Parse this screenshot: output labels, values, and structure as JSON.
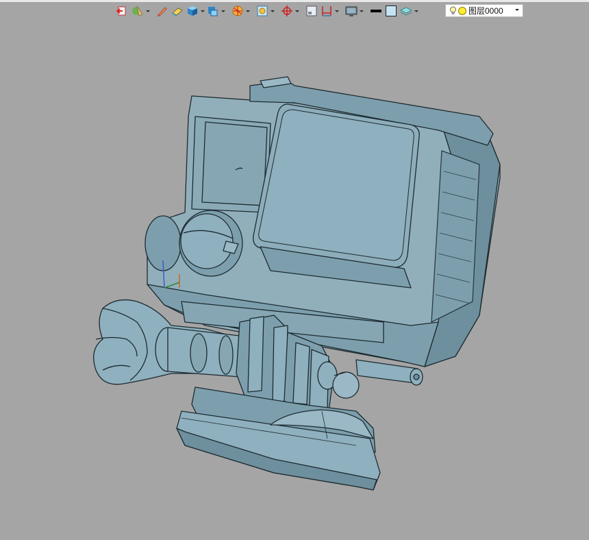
{
  "toolbar": {
    "items": [
      {
        "name": "exit-icon",
        "caret": false
      },
      {
        "name": "render-mode-icon",
        "caret": true
      },
      {
        "name": "pen-icon",
        "caret": false
      },
      {
        "name": "eraser-icon",
        "caret": false
      },
      {
        "name": "cube-icon",
        "caret": true
      },
      {
        "name": "solid-view-icon",
        "caret": true
      },
      {
        "name": "sphere-icon",
        "caret": true
      },
      {
        "name": "frame-icon",
        "caret": true
      },
      {
        "name": "target-icon",
        "caret": true
      },
      {
        "name": "layout-icon",
        "caret": false
      },
      {
        "name": "dimension-icon",
        "caret": true
      },
      {
        "name": "display-icon",
        "caret": true
      },
      {
        "name": "line-weight-icon",
        "caret": false
      },
      {
        "name": "color-swatch-icon",
        "caret": false
      },
      {
        "name": "layers-icon",
        "caret": true
      }
    ]
  },
  "layer": {
    "current": "图层0000"
  },
  "colors": {
    "background": "#a5a5a5",
    "model_fill": "#8fb0be",
    "model_edge": "#1c2a30"
  }
}
